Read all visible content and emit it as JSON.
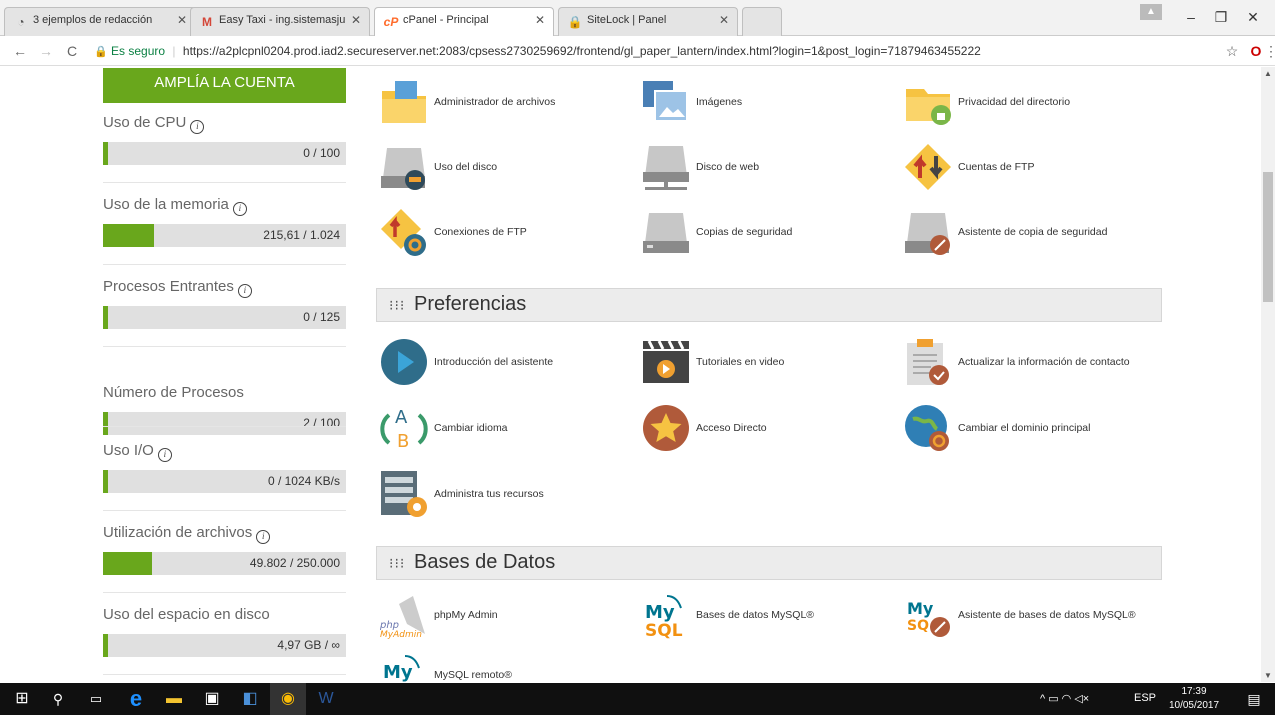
{
  "browser": {
    "tabs": [
      {
        "title": "3 ejemplos de redacción",
        "icon": "whatsapp-icon"
      },
      {
        "title": "Easy Taxi - ing.sistemasju",
        "icon": "gmail-icon"
      },
      {
        "title": "cPanel - Principal",
        "icon": "cpanel-icon"
      },
      {
        "title": "SiteLock | Panel",
        "icon": "sitelock-icon"
      }
    ],
    "secure_label": "Es seguro",
    "url": "https://a2plcpnl0204.prod.iad2.secureserver.net:2083/cpsess2730259692/frontend/gl_paper_lantern/index.html?login=1&post_login=71879463455222"
  },
  "sidebar": {
    "button": "AMPLÍA LA CUENTA",
    "metrics": [
      {
        "label": "Uso de CPU",
        "value": "0 / 100",
        "fill": 0.02,
        "info": true
      },
      {
        "label": "Uso de la memoria",
        "value": "215,61 / 1.024",
        "fill": 0.21,
        "info": true
      },
      {
        "label": "Procesos Entrantes",
        "value": "0 / 125",
        "fill": 0.02,
        "info": true
      },
      {
        "label": "Número de Procesos",
        "value": "2 / 100",
        "fill": 0.02,
        "info": false
      },
      {
        "label": "Uso I/O",
        "value": "0 / 1024 KB/s",
        "fill": 0.02,
        "info": true
      },
      {
        "label": "Utilización de archivos",
        "value": "49.802 / 250.000",
        "fill": 0.2,
        "info": true
      },
      {
        "label": "Uso del espacio en disco",
        "value": "4,97 GB / ∞",
        "fill": 0.02,
        "info": false
      }
    ]
  },
  "files": [
    {
      "label": "Administrador de archivos",
      "icon": "folder-image-icon"
    },
    {
      "label": "Imágenes",
      "icon": "images-icon"
    },
    {
      "label": "Privacidad del directorio",
      "icon": "folder-lock-icon"
    },
    {
      "label": "Uso del disco",
      "icon": "disk-usage-icon"
    },
    {
      "label": "Disco de web",
      "icon": "web-disk-icon"
    },
    {
      "label": "Cuentas de FTP",
      "icon": "ftp-arrows-icon"
    },
    {
      "label": "Conexiones de FTP",
      "icon": "ftp-connections-icon"
    },
    {
      "label": "Copias de seguridad",
      "icon": "backup-drive-icon"
    },
    {
      "label": "Asistente de copia de seguridad",
      "icon": "backup-wizard-icon"
    }
  ],
  "preferences": {
    "title": "Preferencias",
    "items": [
      {
        "label": "Introducción del asistente",
        "icon": "play-circle-icon"
      },
      {
        "label": "Tutoriales en video",
        "icon": "video-clapper-icon"
      },
      {
        "label": "Actualizar la información de contacto",
        "icon": "contact-clipboard-icon"
      },
      {
        "label": "Cambiar idioma",
        "icon": "language-ab-icon"
      },
      {
        "label": "Acceso Directo",
        "icon": "star-circle-icon"
      },
      {
        "label": "Cambiar el dominio principal",
        "icon": "globe-refresh-icon"
      },
      {
        "label": "Administra tus recursos",
        "icon": "server-gear-icon"
      }
    ]
  },
  "databases": {
    "title": "Bases de Datos",
    "items": [
      {
        "label": "phpMy Admin",
        "icon": "phpmyadmin-icon"
      },
      {
        "label": "Bases de datos MySQL®",
        "icon": "mysql-icon"
      },
      {
        "label": "Asistente de bases de datos MySQL®",
        "icon": "mysql-wizard-icon"
      },
      {
        "label": "MySQL remoto®",
        "icon": "mysql-remote-icon"
      }
    ]
  },
  "taskbar": {
    "lang": "ESP",
    "time": "17:39",
    "date": "10/05/2017"
  },
  "colors": {
    "accent": "#69a71c"
  }
}
